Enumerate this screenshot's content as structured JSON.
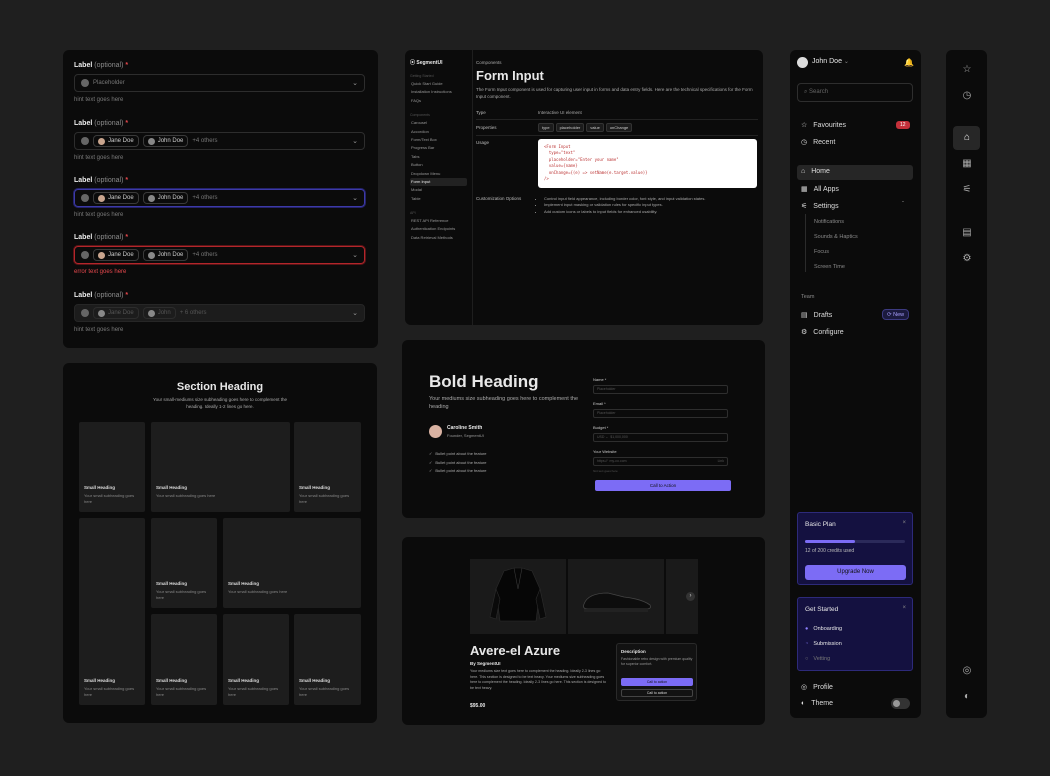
{
  "inputs": {
    "label": "Label",
    "optional": "(optional)",
    "required": "*",
    "placeholder": "Placeholder",
    "hint": "hint text goes here",
    "error": "error text goes here",
    "chip1": "Jane Doe",
    "chip2": "John Doe",
    "chip2_disabled": "John",
    "others": "+4 others",
    "others_disabled": "+ 6 others"
  },
  "docs": {
    "brand": "SegmentUI",
    "sidebar_sections": [
      {
        "title": "Getting Started",
        "items": [
          "Quick Start Guide",
          "Installation Instructions",
          "FAQs"
        ]
      },
      {
        "title": "Components",
        "items": [
          "Carousel",
          "Accordion",
          "Form/Text Box",
          "Progress Bar",
          "Tabs",
          "Button",
          "Dropdown Menu",
          "Form Input",
          "Modal",
          "Table"
        ]
      },
      {
        "title": "API",
        "items": [
          "REST API Reference",
          "Authentication Endpoints",
          "Data Retrieval Methods"
        ]
      }
    ],
    "active_item": "Form Input",
    "breadcrumb": "Components",
    "title": "Form Input",
    "description": "The Form Input component is used for capturing user input in forms and data entry fields. Here are the technical specifications for the Form Input component.",
    "type_label": "Type",
    "type_value": "Interactive UI element",
    "properties_label": "Properties",
    "properties": [
      "type",
      "placeholder",
      "value",
      "onChange"
    ],
    "usage_label": "Usage",
    "code": [
      "<Form Input",
      "  type=\"text\"",
      "  placeholder=\"Enter your name\"",
      "  value={name}",
      "  onChange={(e) => setName(e.target.value)}",
      "/>"
    ],
    "custom_label": "Customization Options",
    "custom": [
      "Control input field appearance, including border color, font style, and input validation states.",
      "Implement input masking or validation rules for specific input types.",
      "Add custom icons or labels to input fields for enhanced usability."
    ]
  },
  "grid": {
    "title": "Section Heading",
    "subtitle": "Your small-mediums size subheading goes here to complement the heading. Ideally 1-2 lines go here.",
    "tile_heading": "Small Heading",
    "tile_sub": "Your small subheading goes here"
  },
  "form": {
    "title": "Bold Heading",
    "subtitle": "Your mediums size subheading goes here to complement the heading",
    "author_name": "Caroline Smith",
    "author_role": "Founder, SegmentUI",
    "bullets": [
      "Bullet point about the feature",
      "Bullet point about the feature",
      "Bullet point about the feature"
    ],
    "name_label": "Name *",
    "name_ph": "Placeholder",
    "email_label": "Email *",
    "email_ph": "Placeholder",
    "budget_label": "Budget *",
    "budget_prefix": "USD",
    "budget_ph": "$1,000,000",
    "web_label": "Your Website",
    "web_prefix": "https://",
    "web_ph": "my-co.com",
    "web_suffix": "Link",
    "hint": "hint text goes here",
    "cta": "Call to Action"
  },
  "product": {
    "title": "Avere-el Azure",
    "by": "By SegmentUI",
    "desc": "Your mediums size text goes here to complement the heading. Ideally 2-3 lines go here. This section is designed to be text heavy. Your mediums size subheading goes here to complement the heading. Ideally 2-3 lines go here. This section is designed to be text heavy.",
    "price": "$95.00",
    "panel_title": "Description",
    "panel_text": "Fashionable retro design with premium quality for superior comfort.",
    "primary": "Call to action",
    "secondary": "Call to action"
  },
  "nav": {
    "user": "John Doe",
    "search_ph": "Search",
    "favourites": "Favourites",
    "fav_count": "12",
    "recent": "Recent",
    "home": "Home",
    "all_apps": "All Apps",
    "settings": "Settings",
    "settings_sub": [
      "Notifications",
      "Sounds & Haptics",
      "Focus",
      "Screen Time"
    ],
    "team": "Team",
    "drafts": "Drafts",
    "new_badge": "New",
    "configure": "Configure",
    "plan_title": "Basic Plan",
    "plan_progress": 0.5,
    "plan_usage": "12 of 200 credits used",
    "upgrade": "Upgrade Now",
    "started_title": "Get Started",
    "steps": [
      "Onboarding",
      "Submission",
      "Vetting"
    ],
    "profile": "Profile",
    "theme": "Theme",
    "accent": "#7c6cf5"
  }
}
